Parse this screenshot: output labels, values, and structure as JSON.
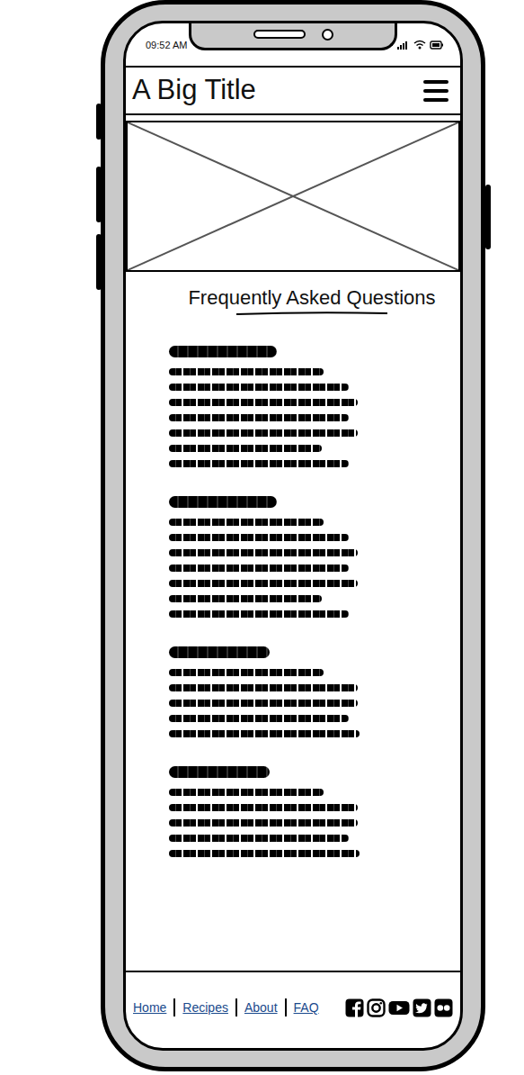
{
  "status_bar": {
    "time": "09:52 AM"
  },
  "header": {
    "title": "A Big Title"
  },
  "faq": {
    "title": "Frequently Asked Questions"
  },
  "footer": {
    "links": [
      {
        "label": "Home"
      },
      {
        "label": "Recipes"
      },
      {
        "label": "About"
      },
      {
        "label": "FAQ"
      }
    ]
  }
}
